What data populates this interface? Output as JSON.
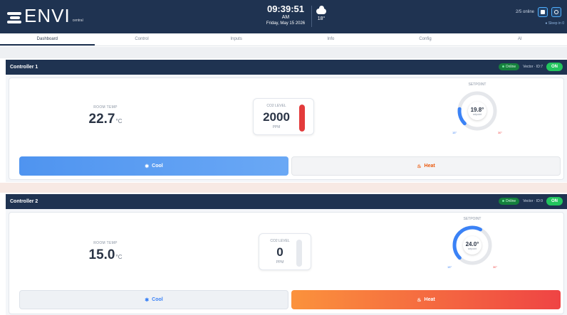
{
  "header": {
    "logo_text": "ENVI",
    "logo_sub": "central",
    "time": "09:39:51",
    "ampm": "AM",
    "date": "Friday, May 15 2026",
    "weather_temp": "18°",
    "online_text": "2/5 online",
    "sleep_text": "● Sleep in 0"
  },
  "tabs": [
    {
      "label": "Dashboard",
      "active": true
    },
    {
      "label": "Control",
      "active": false
    },
    {
      "label": "Inputs",
      "active": false
    },
    {
      "label": "Info",
      "active": false
    },
    {
      "label": "Config",
      "active": false
    },
    {
      "label": "AI",
      "active": false
    }
  ],
  "controllers": [
    {
      "title": "Controller 1",
      "status": "Online",
      "vector": "Vector · ID:7",
      "toggle": "ON",
      "room_temp_label": "ROOM TEMP",
      "room_temp": "22.7",
      "room_temp_unit": "°C",
      "co2_label": "CO2 LEVEL",
      "co2_value": "2000",
      "co2_unit": "PPM",
      "co2_fill": 1.0,
      "setpoint_label": "SETPOINT",
      "setpoint_value": "19.8°",
      "setpoint_sub": "setpoint",
      "setpoint_fraction": 0.19,
      "range_min": "15°",
      "range_max": "30°",
      "cool_label": "Cool",
      "heat_label": "Heat",
      "mode": "cool"
    },
    {
      "title": "Controller 2",
      "status": "Online",
      "vector": "Vector · ID:9",
      "toggle": "ON",
      "room_temp_label": "ROOM TEMP",
      "room_temp": "15.0",
      "room_temp_unit": "°C",
      "co2_label": "CO2 LEVEL",
      "co2_value": "0",
      "co2_unit": "PPM",
      "co2_fill": 0.0,
      "setpoint_label": "SETPOINT",
      "setpoint_value": "24.0°",
      "setpoint_sub": "setpoint",
      "setpoint_fraction": 0.6,
      "range_min": "15°",
      "range_max": "30°",
      "cool_label": "Cool",
      "heat_label": "Heat",
      "mode": "heat"
    }
  ],
  "colors": {
    "header_bg": "#1f3351",
    "online_green": "#22c55e",
    "cool_blue": "#4f94f0",
    "heat_orange": "#fb923c",
    "co2_red": "#e33b3b"
  },
  "icons": {
    "logo": "envi-logo-icon",
    "weather": "cloud-icon",
    "cool": "snowflake-icon",
    "heat": "flame-icon"
  }
}
